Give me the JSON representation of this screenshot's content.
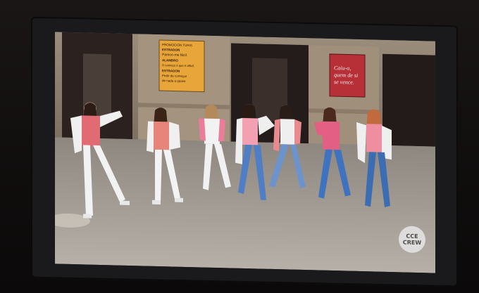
{
  "posters": {
    "yellow": {
      "lines": [
        "PROMOCIÓN TURIS",
        "ESTRADON",
        "Parece-me fácil.",
        "ALAMBRO",
        "O começo é que é difícil.",
        "ESTRADON",
        "Pedir de começar",
        "de nada a quase"
      ]
    },
    "red": {
      "lines": [
        "Caiu-o,",
        "quem de si",
        "se vence."
      ]
    }
  },
  "watermark": {
    "line1": "CCE",
    "line2": "CREW"
  },
  "colors": {
    "pavement": "#9c968f",
    "building": "#8a7a68",
    "poster_yellow": "#e8a53a",
    "poster_red": "#b73038",
    "pink_top": "#e86a86",
    "denim": "#4a78c0",
    "white": "#ededed"
  }
}
